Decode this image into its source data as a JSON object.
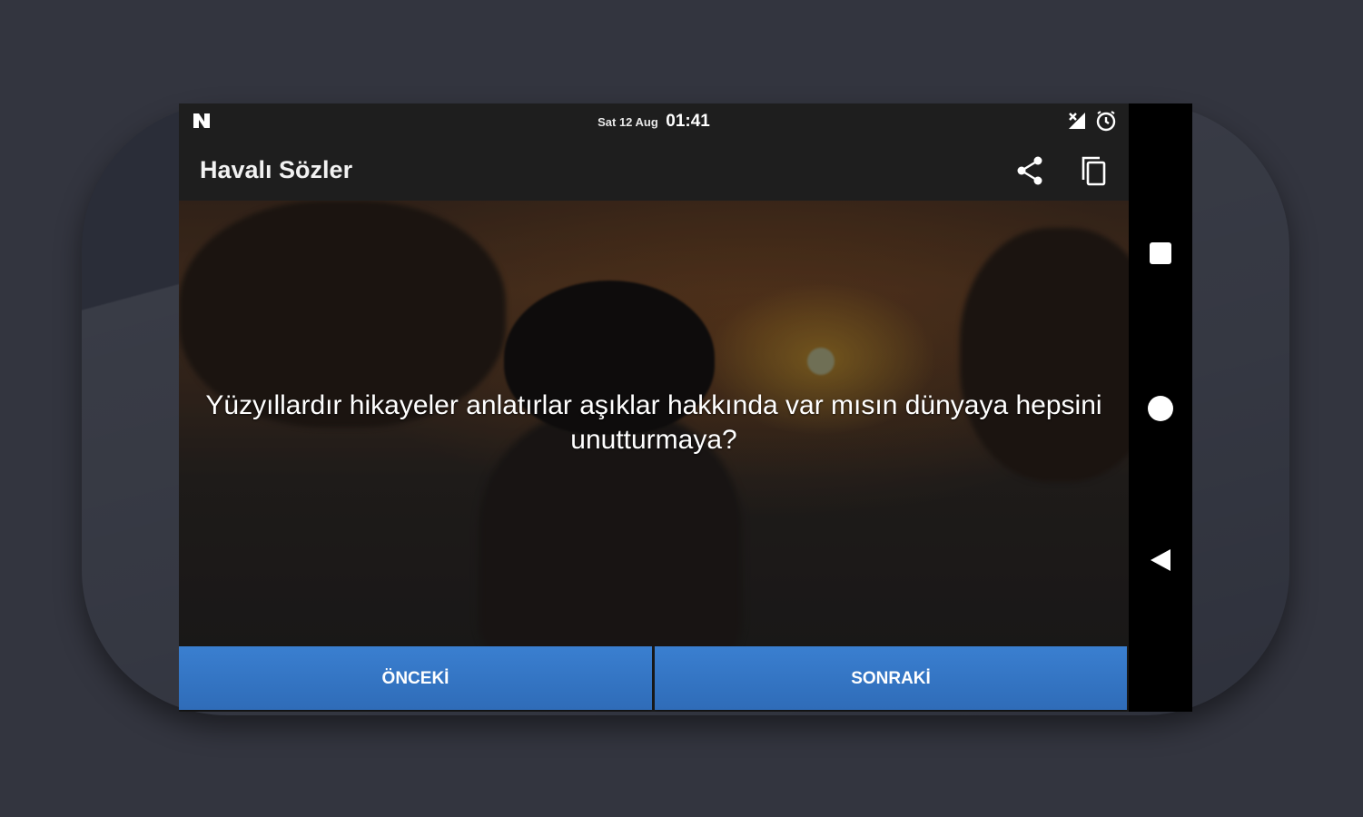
{
  "status_bar": {
    "date": "Sat 12 Aug",
    "time": "01:41",
    "left_icon": "n-icon",
    "right_icons": [
      "signal-icon",
      "alarm-icon"
    ]
  },
  "app_bar": {
    "title": "Havalı Sözler",
    "actions": [
      "share-icon",
      "copy-icon"
    ]
  },
  "quote": {
    "text": "Yüzyıllardır hikayeler anlatırlar aşıklar hakkında var mısın dünyaya hepsini unutturmaya?"
  },
  "buttons": {
    "previous": "ÖNCEKİ",
    "next": "SONRAKİ"
  },
  "nav_bar": {
    "icons": [
      "recents-icon",
      "home-icon",
      "back-icon"
    ]
  },
  "colors": {
    "background": "#33353f",
    "app_bar": "#1e1e1e",
    "button": "#3a7fd0",
    "nav_bar": "#000000"
  }
}
